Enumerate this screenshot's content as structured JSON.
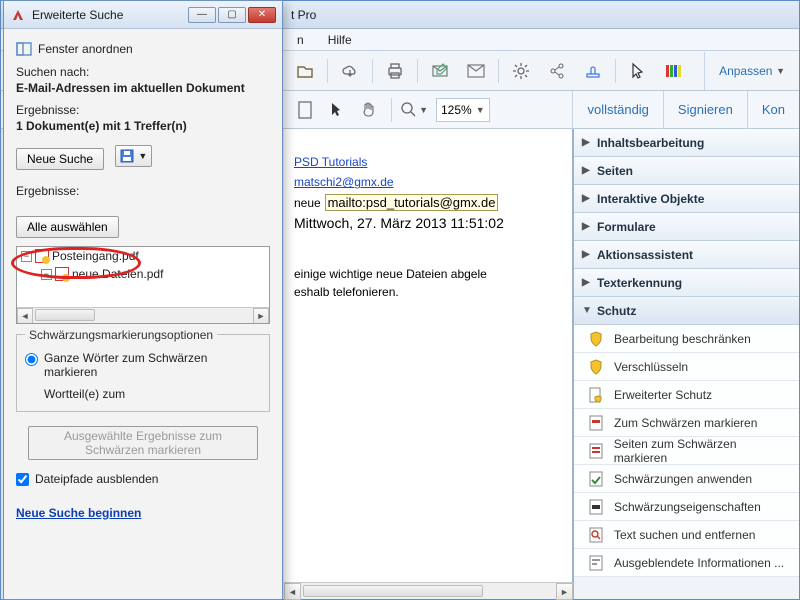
{
  "app": {
    "title_fragment": "t Pro",
    "menu": {
      "help": "Hilfe"
    }
  },
  "toolbar": {
    "zoom_value": "125%",
    "right": {
      "anpassen": "Anpassen",
      "vollstaendig": "vollständig",
      "signieren": "Signieren",
      "kommentar": "Kon"
    }
  },
  "document": {
    "link1": "PSD Tutorials",
    "link2": "matschi2@gmx.de",
    "neue_prefix": "neue",
    "mailto": "mailto:psd_tutorials@gmx.de",
    "date": "Mittwoch, 27. März 2013 11:51:02",
    "body_line1": "einige wichtige neue Dateien abgele",
    "body_line2": "eshalb telefonieren."
  },
  "right_panel": {
    "sections": {
      "inhalt": "Inhaltsbearbeitung",
      "seiten": "Seiten",
      "interaktive": "Interaktive Objekte",
      "formulare": "Formulare",
      "aktion": "Aktionsassistent",
      "text": "Texterkennung",
      "schutz": "Schutz"
    },
    "schutz_items": {
      "bearbeitung": "Bearbeitung beschränken",
      "verschluesseln": "Verschlüsseln",
      "erweiterter": "Erweiterter Schutz",
      "zum_schwaerzen": "Zum Schwärzen markieren",
      "seiten_schwaerzen": "Seiten zum Schwärzen markieren",
      "anwenden": "Schwärzungen anwenden",
      "eigenschaften": "Schwärzungseigenschaften",
      "text_entfernen": "Text suchen und entfernen",
      "ausgeblendete": "Ausgeblendete Informationen ..."
    }
  },
  "search": {
    "title": "Erweiterte Suche",
    "arrange": "Fenster anordnen",
    "suchen_nach": "Suchen nach:",
    "suchen_nach_val": "E-Mail-Adressen im aktuellen Dokument",
    "ergebnisse_lbl": "Ergebnisse:",
    "ergebnisse_val": "1 Dokument(e) mit 1 Treffer(n)",
    "neue_suche_btn": "Neue Suche",
    "ergebnisse2": "Ergebnisse:",
    "alle_auswaehlen": "Alle auswählen",
    "tree": {
      "root": "Posteingang.pdf",
      "child": "neue Dateien.pdf"
    },
    "fieldset_legend": "Schwärzungsmarkierungsoptionen",
    "radio_ganze": "Ganze Wörter zum Schwärzen markieren",
    "radio_teil": "Wortteil(e) zum",
    "apply_btn": "Ausgewählte Ergebnisse zum Schwärzen markieren",
    "chk_pfade": "Dateipfade ausblenden",
    "neue_suche_link": "Neue Suche beginnen"
  }
}
